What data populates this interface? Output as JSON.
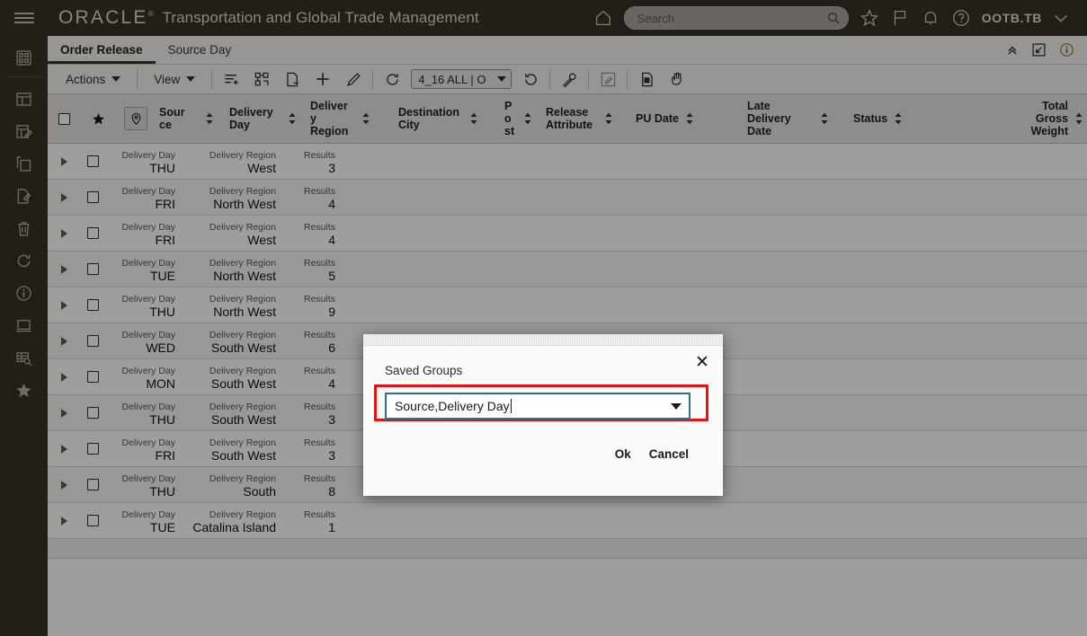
{
  "header": {
    "brand": "ORACLE",
    "brand_mark": "®",
    "app_title": "Transportation and Global Trade Management",
    "search_placeholder": "Search",
    "search_value": "",
    "username": "OOTB.TB",
    "icons": [
      "menu-icon",
      "home-icon",
      "search-icon",
      "star-icon",
      "flag-icon",
      "bell-icon",
      "help-icon",
      "user-chevron-icon"
    ]
  },
  "sidebar": {
    "items": [
      {
        "name": "dashboard-icon",
        "label": "Dashboard"
      },
      {
        "name": "layout-icon",
        "label": "Layout"
      },
      {
        "name": "edit-table-icon",
        "label": "Edit Table"
      },
      {
        "name": "copy-icon",
        "label": "Copy"
      },
      {
        "name": "edit-document-icon",
        "label": "Edit Document"
      },
      {
        "name": "trash-icon",
        "label": "Delete"
      },
      {
        "name": "refresh-icon",
        "label": "Refresh"
      },
      {
        "name": "info-icon",
        "label": "Info"
      },
      {
        "name": "monitor-icon",
        "label": "Monitor"
      },
      {
        "name": "table-search-icon",
        "label": "Find in Table"
      },
      {
        "name": "favorites-star-icon",
        "label": "Favorites"
      }
    ]
  },
  "tabs": {
    "items": [
      {
        "label": "Order Release",
        "active": true
      },
      {
        "label": "Source Day",
        "active": false
      }
    ],
    "right_icons": [
      "collapse-chevron-icon",
      "restore-down-icon",
      "info-circle-icon"
    ]
  },
  "toolbar": {
    "actions_label": "Actions",
    "view_label": "View",
    "saved_query_value": "4_16 ALL | O",
    "icons": [
      "add-to-list-icon",
      "process-flow-icon",
      "remove-document-icon",
      "add-icon",
      "edit-pencil-icon",
      "refresh-circle-icon",
      "reload-icon",
      "wrench-icon",
      "edit-disabled-icon",
      "duplicate-document-icon",
      "hand-icon"
    ]
  },
  "table": {
    "columns": [
      {
        "label": "",
        "name": "select-all-checkbox",
        "sortable": false
      },
      {
        "label": "",
        "name": "favorite-star-header",
        "sortable": false
      },
      {
        "label": "",
        "name": "pin-location-header",
        "sortable": false
      },
      {
        "label": "Sour ce",
        "name": "col-source",
        "sortable": true
      },
      {
        "label": "Delivery Day",
        "name": "col-delivery-day",
        "sortable": true
      },
      {
        "label": "Deliver y Region",
        "name": "col-delivery-region",
        "sortable": true
      },
      {
        "label": "Destination City",
        "name": "col-destination-city",
        "sortable": true
      },
      {
        "label": "P o st",
        "name": "col-post",
        "sortable": true
      },
      {
        "label": "Release Attribute",
        "name": "col-release-attribute",
        "sortable": true
      },
      {
        "label": "PU Date",
        "name": "col-pu-date",
        "sortable": true
      },
      {
        "label": "Late Delivery Date",
        "name": "col-late-delivery-date",
        "sortable": true
      },
      {
        "label": "Status",
        "name": "col-status",
        "sortable": true
      },
      {
        "label": "Total Gross Weight",
        "name": "col-total-gross-weight",
        "sortable": true
      }
    ],
    "group_keys": {
      "delivery_day": "Delivery Day",
      "delivery_region": "Delivery Region",
      "results": "Results"
    },
    "rows": [
      {
        "delivery_day": "THU",
        "delivery_region": "West",
        "results": "3"
      },
      {
        "delivery_day": "FRI",
        "delivery_region": "North West",
        "results": "4"
      },
      {
        "delivery_day": "FRI",
        "delivery_region": "West",
        "results": "4"
      },
      {
        "delivery_day": "TUE",
        "delivery_region": "North West",
        "results": "5"
      },
      {
        "delivery_day": "THU",
        "delivery_region": "North West",
        "results": "9"
      },
      {
        "delivery_day": "WED",
        "delivery_region": "South West",
        "results": "6"
      },
      {
        "delivery_day": "MON",
        "delivery_region": "South West",
        "results": "4"
      },
      {
        "delivery_day": "THU",
        "delivery_region": "South West",
        "results": "3"
      },
      {
        "delivery_day": "FRI",
        "delivery_region": "South West",
        "results": "3"
      },
      {
        "delivery_day": "THU",
        "delivery_region": "South",
        "results": "8"
      },
      {
        "delivery_day": "TUE",
        "delivery_region": "Catalina Island",
        "results": "1"
      }
    ]
  },
  "modal": {
    "title": "Saved Groups",
    "combo_value": "Source,Delivery Day",
    "ok_label": "Ok",
    "cancel_label": "Cancel",
    "close_glyph": "✕"
  },
  "colors": {
    "brand_bar": "#3a3129",
    "accent_focus": "#2b7189",
    "highlight_box": "#e8110f",
    "header_row": "#e6e4e2"
  }
}
